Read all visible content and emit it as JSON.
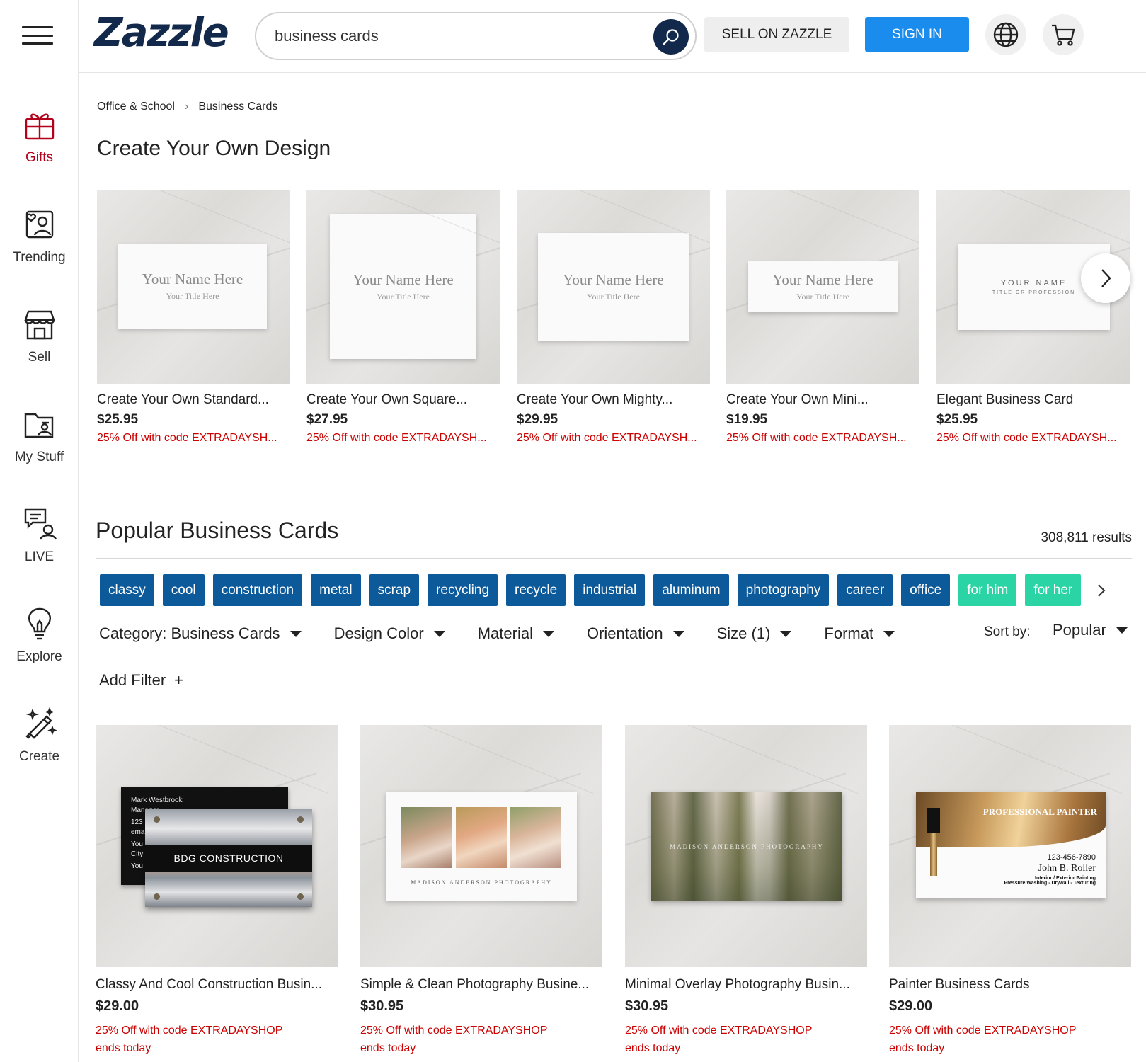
{
  "header": {
    "logo": "Zazzle",
    "search_value": "business cards",
    "sell_label": "SELL ON ZAZZLE",
    "signin_label": "SIGN IN"
  },
  "sidebar": {
    "items": [
      {
        "label": "Gifts",
        "icon": "gift-icon"
      },
      {
        "label": "Trending",
        "icon": "trending-icon"
      },
      {
        "label": "Sell",
        "icon": "store-icon"
      },
      {
        "label": "My Stuff",
        "icon": "folder-icon"
      },
      {
        "label": "LIVE",
        "icon": "live-chat-icon"
      },
      {
        "label": "Explore",
        "icon": "lightbulb-icon"
      },
      {
        "label": "Create",
        "icon": "magic-pen-icon"
      }
    ]
  },
  "breadcrumb": [
    "Office & School",
    "Business Cards"
  ],
  "create_section": {
    "title": "Create Your Own Design",
    "products": [
      {
        "title": "Create Your Own Standard...",
        "price": "$25.95",
        "promo": "25% Off with code EXTRADAYSH...",
        "card_name": "Your Name Here",
        "card_title": "Your Title Here"
      },
      {
        "title": "Create Your Own Square...",
        "price": "$27.95",
        "promo": "25% Off with code EXTRADAYSH...",
        "card_name": "Your Name Here",
        "card_title": "Your Title Here"
      },
      {
        "title": "Create Your Own Mighty...",
        "price": "$29.95",
        "promo": "25% Off with code EXTRADAYSH...",
        "card_name": "Your Name Here",
        "card_title": "Your Title Here"
      },
      {
        "title": "Create Your Own Mini...",
        "price": "$19.95",
        "promo": "25% Off with code EXTRADAYSH...",
        "card_name": "Your Name Here",
        "card_title": "Your Title Here"
      },
      {
        "title": "Elegant Business Card",
        "price": "$25.95",
        "promo": "25% Off with code EXTRADAYSH...",
        "card_name": "YOUR NAME",
        "card_title": "TITLE OR PROFESSION"
      }
    ]
  },
  "popular_section": {
    "title": "Popular Business Cards",
    "results": "308,811 results",
    "tags": [
      {
        "label": "classy"
      },
      {
        "label": "cool"
      },
      {
        "label": "construction"
      },
      {
        "label": "metal"
      },
      {
        "label": "scrap"
      },
      {
        "label": "recycling"
      },
      {
        "label": "recycle"
      },
      {
        "label": "industrial"
      },
      {
        "label": "aluminum"
      },
      {
        "label": "photography"
      },
      {
        "label": "career"
      },
      {
        "label": "office"
      },
      {
        "label": "for him"
      },
      {
        "label": "for her"
      }
    ],
    "filters": [
      "Category: Business Cards",
      "Design Color",
      "Material",
      "Orientation",
      "Size (1)",
      "Format"
    ],
    "sort_label": "Sort by:",
    "sort_value": "Popular",
    "add_filter": "Add Filter",
    "add_filter_icon": "+",
    "products": [
      {
        "title": "Classy And Cool Construction Busin...",
        "price": "$29.00",
        "promo": "25% Off with code EXTRADAYSHOP",
        "promo_note": "ends today",
        "card_text": {
          "name": "Mark Westbrook",
          "role": "Manager",
          "brand": "BDG CONSTRUCTION",
          "phone_frag": "123",
          "email_frag": "ema",
          "addr1_frag": "You",
          "addr2_frag": "City",
          "addr3_frag": "You"
        }
      },
      {
        "title": "Simple & Clean Photography Busine...",
        "price": "$30.95",
        "promo": "25% Off with code EXTRADAYSHOP",
        "promo_note": "ends today",
        "card_text": {
          "brand": "MADISON ANDERSON PHOTOGRAPHY"
        }
      },
      {
        "title": "Minimal Overlay Photography Busin...",
        "price": "$30.95",
        "promo": "25% Off with code EXTRADAYSHOP",
        "promo_note": "ends today",
        "card_text": {
          "brand": "MADISON ANDERSON PHOTOGRAPHY"
        }
      },
      {
        "title": "Painter Business Cards",
        "price": "$29.00",
        "promo": "25% Off with code EXTRADAYSHOP",
        "promo_note": "ends today",
        "card_text": {
          "headline": "PROFESSIONAL PAINTER",
          "phone": "123-456-7890",
          "name": "John B. Roller",
          "line1": "Interior / Exterior Painting",
          "line2": "Pressure Washing - Drywall - Texturing"
        }
      }
    ]
  },
  "colors": {
    "brand_navy": "#13294b",
    "signin_blue": "#1a8ced",
    "tag_blue": "#0d5a9b",
    "tag_green": "#2bd4a4",
    "promo_red": "#cc0000",
    "gifts_red": "#b3001b"
  }
}
